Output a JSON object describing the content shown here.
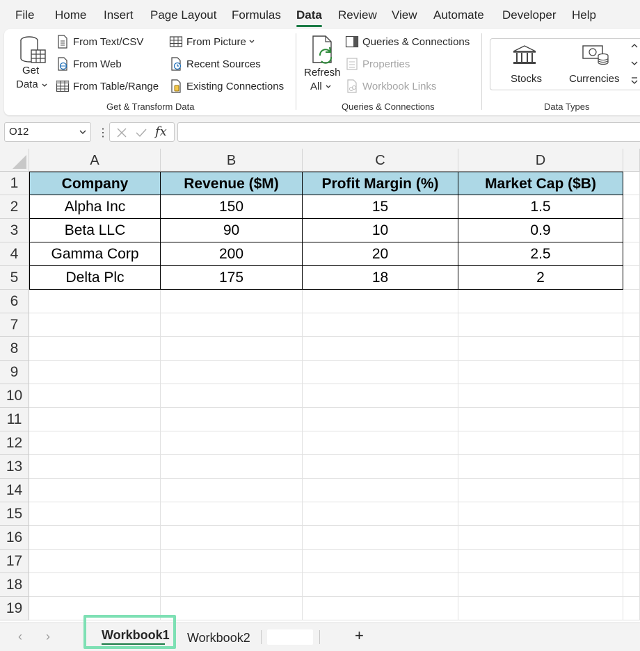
{
  "menu": {
    "tabs": [
      {
        "label": "File"
      },
      {
        "label": "Home"
      },
      {
        "label": "Insert"
      },
      {
        "label": "Page Layout"
      },
      {
        "label": "Formulas"
      },
      {
        "label": "Data",
        "active": true
      },
      {
        "label": "Review"
      },
      {
        "label": "View"
      },
      {
        "label": "Automate"
      },
      {
        "label": "Developer"
      },
      {
        "label": "Help"
      }
    ]
  },
  "ribbon": {
    "get_transform": {
      "get_data_line1": "Get",
      "get_data_line2": "Data",
      "from_text_csv": "From Text/CSV",
      "from_web": "From Web",
      "from_table_range": "From Table/Range",
      "from_picture": "From Picture",
      "recent_sources": "Recent Sources",
      "existing_connections": "Existing Connections",
      "group_label": "Get & Transform Data"
    },
    "queries": {
      "refresh_line1": "Refresh",
      "refresh_line2": "All",
      "queries_connections": "Queries & Connections",
      "properties": "Properties",
      "workbook_links": "Workbook Links",
      "group_label": "Queries & Connections"
    },
    "data_types": {
      "stocks": "Stocks",
      "currencies": "Currencies",
      "group_label": "Data Types"
    }
  },
  "formula_bar": {
    "name_box": "O12",
    "fx": "fx",
    "value": ""
  },
  "sheet": {
    "columns": [
      "A",
      "B",
      "C",
      "D"
    ],
    "rows": [
      "1",
      "2",
      "3",
      "4",
      "5",
      "6",
      "7",
      "8",
      "9",
      "10",
      "11",
      "12",
      "13",
      "14",
      "15",
      "16",
      "17",
      "18",
      "19"
    ],
    "table": [
      [
        "Company",
        "Revenue ($M)",
        "Profit Margin (%)",
        "Market Cap ($B)"
      ],
      [
        "Alpha Inc",
        "150",
        "15",
        "1.5"
      ],
      [
        "Beta LLC",
        "90",
        "10",
        "0.9"
      ],
      [
        "Gamma Corp",
        "200",
        "20",
        "2.5"
      ],
      [
        "Delta Plc",
        "175",
        "18",
        "2"
      ]
    ],
    "header_fill": "#add8e6"
  },
  "sheet_tabs": {
    "tabs": [
      {
        "label": "Workbook1",
        "active": true
      },
      {
        "label": "Workbook2"
      }
    ],
    "add_label": "+"
  },
  "colors": {
    "accent": "#1a7a44",
    "highlight": "#7ee0b4"
  }
}
